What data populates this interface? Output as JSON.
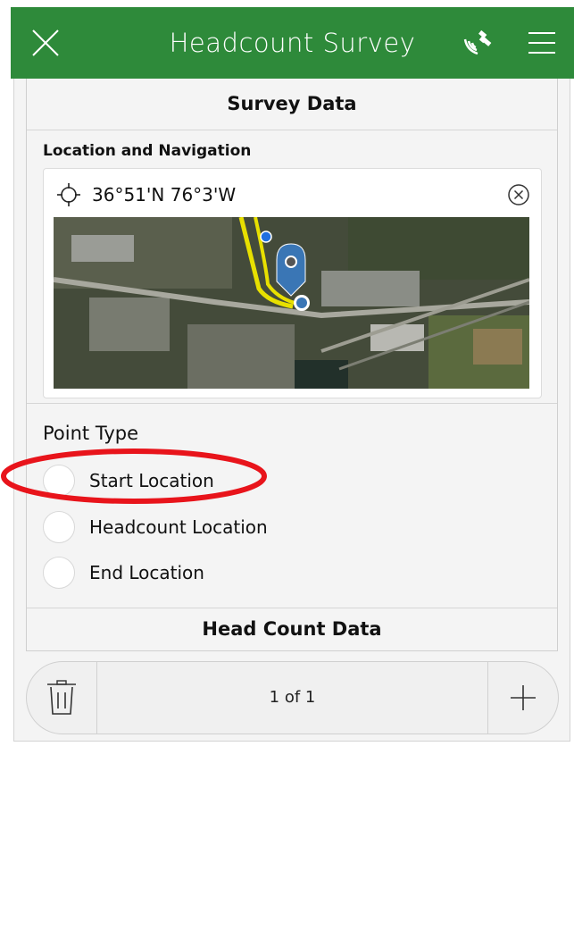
{
  "header": {
    "title": "Headcount Survey",
    "bg_color": "#2e8a3a",
    "icons": [
      "close-icon",
      "gps-satellite-icon",
      "menu-icon"
    ]
  },
  "survey_group": {
    "title": "Survey Data"
  },
  "location": {
    "label": "Location and Navigation",
    "coordinates": "36°51'N 76°3'W",
    "icons": [
      "crosshair-icon",
      "clear-circle-icon",
      "map-pin-icon"
    ]
  },
  "point_type": {
    "label": "Point Type",
    "options": [
      "Start Location",
      "Headcount Location",
      "End Location"
    ],
    "selected": null
  },
  "headcount_group": {
    "title": "Head Count Data"
  },
  "paging": {
    "text": "1 of 1",
    "icons": [
      "trash-icon",
      "plus-icon"
    ]
  },
  "annotation": {
    "color": "#e8141b",
    "shape": "ellipse-around-start-location"
  }
}
